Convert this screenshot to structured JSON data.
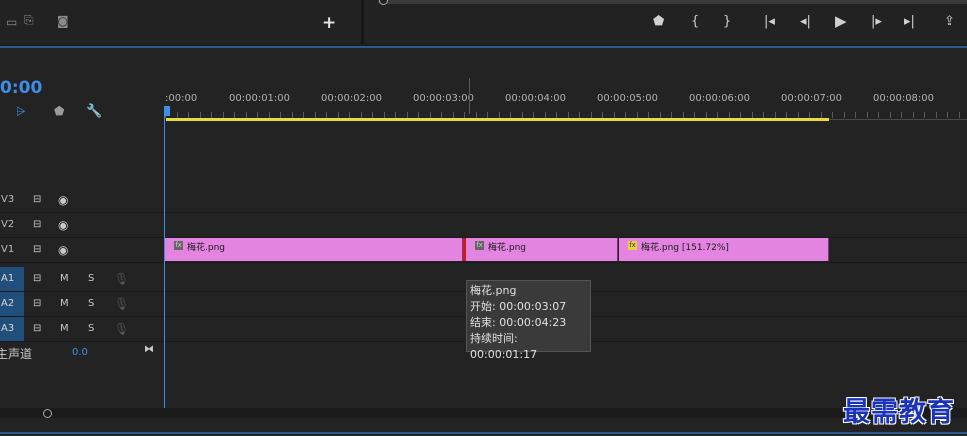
{
  "top": {
    "left_icons": [
      "export-frame-icon",
      "insert-icon",
      "camera-icon"
    ],
    "add_button": "+",
    "controls": [
      "marker-icon",
      "mark-in-icon",
      "mark-out-icon",
      "go-to-in-icon",
      "step-back-icon",
      "play-icon",
      "step-forward-icon",
      "go-to-out-icon",
      "lift-icon"
    ]
  },
  "timeline": {
    "timecode": "0:00",
    "tools": [
      "snap-icon",
      "linked-selection-icon",
      "add-marker-icon",
      "settings-wrench-icon"
    ],
    "ruler_labels": [
      ":00:00",
      "00:00:01:00",
      "00:00:02:00",
      "00:00:03:00",
      "00:00:04:00",
      "00:00:05:00",
      "00:00:06:00",
      "00:00:07:00",
      "00:00:08:00"
    ],
    "video_tracks": [
      {
        "name": "V3"
      },
      {
        "name": "V2"
      },
      {
        "name": "V1"
      }
    ],
    "audio_tracks": [
      {
        "name": "A1",
        "mute": "M",
        "solo": "S"
      },
      {
        "name": "A2",
        "mute": "M",
        "solo": "S"
      },
      {
        "name": "A3",
        "mute": "M",
        "solo": "S"
      }
    ],
    "master": {
      "label": "主声道",
      "value": "0.0"
    },
    "clips": [
      {
        "fx": "fx",
        "name": "梅花.png"
      },
      {
        "fx": "fx",
        "name": "梅花.png"
      },
      {
        "fx": "fx",
        "name": "梅花.png [151.72%]"
      }
    ],
    "tooltip": {
      "title": "梅花.png",
      "start": "开始: 00:00:03:07",
      "end": "结束: 00:00:04:23",
      "duration": "持续时间: 00:00:01:17"
    }
  },
  "watermark": "最需教育",
  "colors": {
    "accent": "#3d8ee8",
    "clip": "#e384e0",
    "work_area": "#e8dc3c",
    "cut": "#cc1a1a",
    "audio_track": "#1f4f7a"
  }
}
